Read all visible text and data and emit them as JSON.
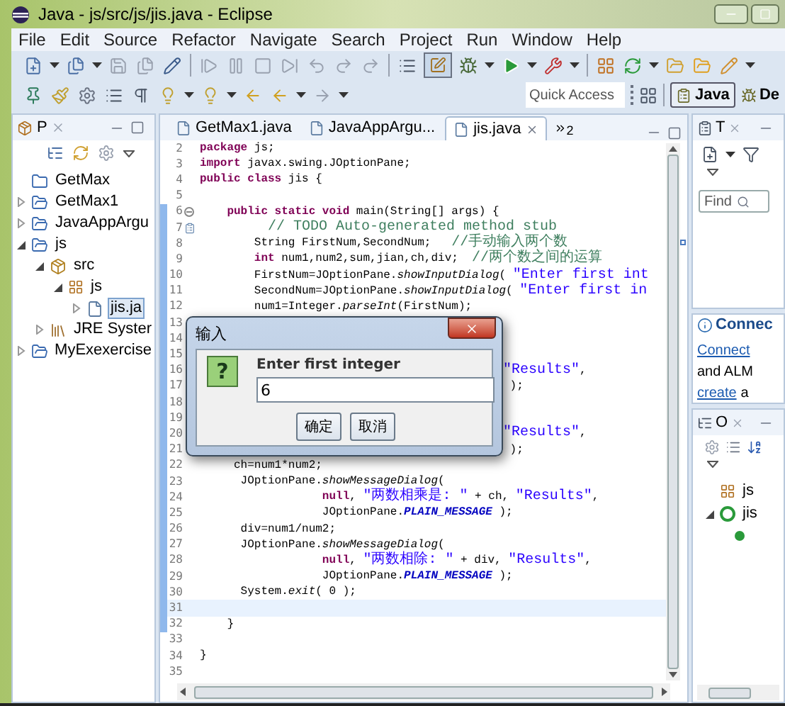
{
  "window": {
    "title": "Java - js/src/js/jis.java - Eclipse"
  },
  "menu": [
    "File",
    "Edit",
    "Source",
    "Refactor",
    "Navigate",
    "Search",
    "Project",
    "Run",
    "Window",
    "Help"
  ],
  "quick_access": {
    "placeholder": "Quick Access"
  },
  "perspectives": [
    {
      "label": "Java",
      "selected": true
    },
    {
      "label": "De",
      "selected": false
    }
  ],
  "package_explorer": {
    "tab": "P",
    "tree": [
      {
        "label": "GetMax",
        "kind": "closed-project",
        "selected": false
      },
      {
        "label": "GetMax1",
        "kind": "project",
        "expanded": false,
        "selected": false
      },
      {
        "label": "JavaAppArgu",
        "kind": "project",
        "expanded": false,
        "selected": false
      },
      {
        "label": "js",
        "kind": "project",
        "expanded": true,
        "selected": false,
        "children": [
          {
            "label": "src",
            "kind": "source-folder",
            "expanded": true,
            "selected": false,
            "children": [
              {
                "label": "js",
                "kind": "package",
                "expanded": true,
                "selected": false,
                "children": [
                  {
                    "label": "jis.ja",
                    "kind": "java-file",
                    "expanded": false,
                    "selected": true
                  }
                ]
              }
            ]
          },
          {
            "label": "JRE Syster",
            "kind": "library",
            "expanded": false,
            "selected": false
          }
        ]
      },
      {
        "label": "MyExexercise",
        "kind": "project",
        "expanded": false,
        "selected": false
      }
    ]
  },
  "editor": {
    "tabs": [
      {
        "label": "GetMax1.java",
        "selected": false
      },
      {
        "label": "JavaAppArgu...",
        "selected": false
      },
      {
        "label": "jis.java",
        "selected": true
      }
    ],
    "overflow_count": "2",
    "lines": [
      {
        "n": "2",
        "changed": false,
        "current": false,
        "tokens": [
          {
            "kind": "kw",
            "text": "package"
          },
          {
            "kind": "txt",
            "text": " js;"
          }
        ]
      },
      {
        "n": "3",
        "changed": false,
        "current": false,
        "tokens": [
          {
            "kind": "kw",
            "text": "import"
          },
          {
            "kind": "txt",
            "text": " javax.swing.JOptionPane;"
          }
        ]
      },
      {
        "n": "4",
        "changed": false,
        "current": false,
        "tokens": [
          {
            "kind": "kw",
            "text": "public class"
          },
          {
            "kind": "txt",
            "text": " jis {"
          }
        ]
      },
      {
        "n": "5",
        "changed": false,
        "current": false
      },
      {
        "n": "6",
        "changed": true,
        "current": false,
        "kind": "fold",
        "tokens": [
          {
            "kind": "kw",
            "text": "    public static void"
          },
          {
            "kind": "txt",
            "text": " main(String[] args) {"
          }
        ]
      },
      {
        "n": "7",
        "changed": true,
        "current": false,
        "kind": "task",
        "tokens": [
          {
            "kind": "cmt",
            "text": "        // TODO Auto-generated method stub"
          }
        ]
      },
      {
        "n": "8",
        "changed": true,
        "current": false,
        "tokens": [
          {
            "kind": "txt",
            "text": "        String FirstNum,SecondNum;   "
          },
          {
            "kind": "cmt",
            "text": "//手动输入两个数"
          }
        ]
      },
      {
        "n": "9",
        "changed": true,
        "current": false,
        "tokens": [
          {
            "kind": "kw",
            "text": "        int"
          },
          {
            "kind": "txt",
            "text": " num1,num2,sum,jian,ch,div;  "
          },
          {
            "kind": "cmt",
            "text": "//两个数之间的运算"
          }
        ]
      },
      {
        "n": "10",
        "changed": true,
        "current": false,
        "tokens": [
          {
            "kind": "txt",
            "text": "        FirstNum=JOptionPane."
          },
          {
            "kind": "mth",
            "text": "showInputDialog"
          },
          {
            "kind": "txt",
            "text": "( "
          },
          {
            "kind": "str",
            "text": "\"Enter first int"
          }
        ]
      },
      {
        "n": "11",
        "changed": true,
        "current": false,
        "tokens": [
          {
            "kind": "txt",
            "text": "        SecondNum=JOptionPane."
          },
          {
            "kind": "mth",
            "text": "showInputDialog"
          },
          {
            "kind": "txt",
            "text": "( "
          },
          {
            "kind": "str",
            "text": "\"Enter first in"
          }
        ]
      },
      {
        "n": "12",
        "changed": true,
        "current": false,
        "tokens": [
          {
            "kind": "txt",
            "text": "        num1=Integer."
          },
          {
            "kind": "mth",
            "text": "parseInt"
          },
          {
            "kind": "txt",
            "text": "(FirstNum);"
          }
        ]
      },
      {
        "n": "13",
        "changed": true,
        "current": false
      },
      {
        "n": "14",
        "changed": true,
        "current": false
      },
      {
        "n": "15",
        "changed": true,
        "current": false
      },
      {
        "n": "16",
        "changed": true,
        "current": false,
        "covered": true,
        "tokens": [
          {
            "kind": "str",
            "text": "\"Results\""
          },
          {
            "kind": "txt",
            "text": ","
          }
        ]
      },
      {
        "n": "17",
        "changed": true,
        "current": false,
        "covered": true,
        "tokens": [
          {
            "kind": "txt",
            "text": " );"
          }
        ]
      },
      {
        "n": "18",
        "changed": true,
        "current": false
      },
      {
        "n": "19",
        "changed": true,
        "current": false
      },
      {
        "n": "20",
        "changed": true,
        "current": false,
        "covered": true,
        "tokens": [
          {
            "kind": "str",
            "text": "\"Results\""
          },
          {
            "kind": "txt",
            "text": ","
          }
        ]
      },
      {
        "n": "21",
        "changed": true,
        "current": false,
        "covered": true,
        "tokens": [
          {
            "kind": "txt",
            "text": " );"
          }
        ]
      },
      {
        "n": "22",
        "changed": true,
        "current": false,
        "tokens": [
          {
            "kind": "txt",
            "text": "     ch=num1*num2;"
          }
        ]
      },
      {
        "n": "23",
        "changed": true,
        "current": false,
        "tokens": [
          {
            "kind": "txt",
            "text": "      JOptionPane."
          },
          {
            "kind": "mth",
            "text": "showMessageDialog"
          },
          {
            "kind": "txt",
            "text": "("
          }
        ]
      },
      {
        "n": "24",
        "changed": true,
        "current": false,
        "tokens": [
          {
            "kind": "kw",
            "text": "                  null"
          },
          {
            "kind": "txt",
            "text": ", "
          },
          {
            "kind": "str",
            "text": "\"两数相乘是: \""
          },
          {
            "kind": "txt",
            "text": " + ch, "
          },
          {
            "kind": "str",
            "text": "\"Results\""
          },
          {
            "kind": "txt",
            "text": ","
          }
        ]
      },
      {
        "n": "25",
        "changed": true,
        "current": false,
        "tokens": [
          {
            "kind": "txt",
            "text": "                  JOptionPane."
          },
          {
            "kind": "cst",
            "text": "PLAIN_MESSAGE"
          },
          {
            "kind": "txt",
            "text": " );"
          }
        ]
      },
      {
        "n": "26",
        "changed": true,
        "current": false,
        "tokens": [
          {
            "kind": "txt",
            "text": "      div=num1/num2;"
          }
        ]
      },
      {
        "n": "27",
        "changed": true,
        "current": false,
        "tokens": [
          {
            "kind": "txt",
            "text": "      JOptionPane."
          },
          {
            "kind": "mth",
            "text": "showMessageDialog"
          },
          {
            "kind": "txt",
            "text": "("
          }
        ]
      },
      {
        "n": "28",
        "changed": true,
        "current": false,
        "tokens": [
          {
            "kind": "kw",
            "text": "                  null"
          },
          {
            "kind": "txt",
            "text": ", "
          },
          {
            "kind": "str",
            "text": "\"两数相除: \""
          },
          {
            "kind": "txt",
            "text": " + div, "
          },
          {
            "kind": "str",
            "text": "\"Results\""
          },
          {
            "kind": "txt",
            "text": ","
          }
        ]
      },
      {
        "n": "29",
        "changed": true,
        "current": false,
        "tokens": [
          {
            "kind": "txt",
            "text": "                  JOptionPane."
          },
          {
            "kind": "cst",
            "text": "PLAIN_MESSAGE"
          },
          {
            "kind": "txt",
            "text": " );"
          }
        ]
      },
      {
        "n": "30",
        "changed": true,
        "current": false,
        "tokens": [
          {
            "kind": "txt",
            "text": "      System."
          },
          {
            "kind": "mth",
            "text": "exit"
          },
          {
            "kind": "txt",
            "text": "( 0 );"
          }
        ]
      },
      {
        "n": "31",
        "changed": true,
        "current": true
      },
      {
        "n": "32",
        "changed": true,
        "current": false,
        "tokens": [
          {
            "kind": "txt",
            "text": "    }"
          }
        ]
      },
      {
        "n": "33",
        "changed": false,
        "current": false
      },
      {
        "n": "34",
        "changed": false,
        "current": false,
        "tokens": [
          {
            "kind": "txt",
            "text": "}"
          }
        ]
      },
      {
        "n": "35",
        "changed": false,
        "current": false
      }
    ]
  },
  "dialog": {
    "title": "输入",
    "icon_glyph": "?",
    "label": "Enter first integer",
    "value": "6",
    "buttons": [
      "确定",
      "取消"
    ]
  },
  "task_list": {
    "tab": "T",
    "find": {
      "placeholder": "Find"
    }
  },
  "connect": {
    "title": "Connec",
    "link": "Connect",
    "text": "and ALM",
    "link2": "create",
    "text2": "a"
  },
  "outline": {
    "tab": "O",
    "tree": [
      {
        "label": "js",
        "kind": "package"
      },
      {
        "label": "jis",
        "kind": "class",
        "expanded": true,
        "children": [
          {
            "kind": "method"
          }
        ]
      }
    ]
  }
}
